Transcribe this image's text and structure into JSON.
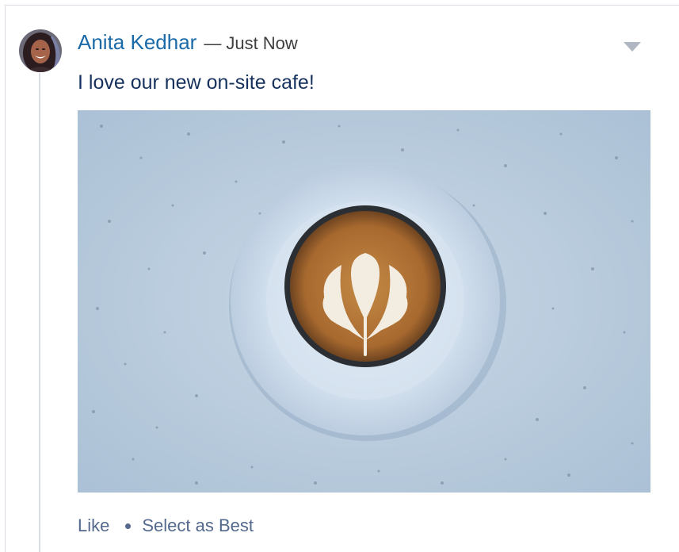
{
  "post": {
    "author_name": "Anita Kedhar",
    "separator": "—",
    "timestamp": "Just Now",
    "body_text": "I love our new on-site cafe!",
    "image_alt": "latte art coffee cup on a white saucer",
    "menu_icon": "chevron-down-icon",
    "avatar_icon": "avatar"
  },
  "actions": {
    "like_label": "Like",
    "select_best_label": "Select as Best"
  },
  "colors": {
    "author_link": "#1b6aa8",
    "body_text": "#16325c",
    "action_text": "#54698d",
    "divider": "#d8dde6"
  }
}
